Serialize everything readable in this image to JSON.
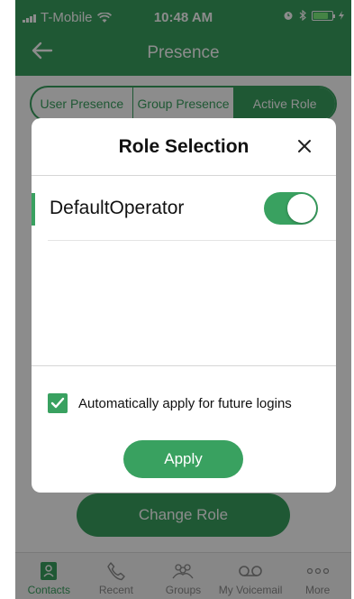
{
  "status_bar": {
    "carrier": "T-Mobile",
    "time": "10:48 AM"
  },
  "header": {
    "title": "Presence",
    "back_icon": "back-arrow-icon"
  },
  "segments": [
    {
      "label": "User Presence",
      "active": false
    },
    {
      "label": "Group Presence",
      "active": false
    },
    {
      "label": "Active Role",
      "active": true
    }
  ],
  "change_role_label": "Change Role",
  "tabs": [
    {
      "label": "Contacts",
      "icon": "contacts-icon",
      "active": true
    },
    {
      "label": "Recent",
      "icon": "phone-icon",
      "active": false
    },
    {
      "label": "Groups",
      "icon": "groups-icon",
      "active": false
    },
    {
      "label": "My Voicemail",
      "icon": "voicemail-icon",
      "active": false
    },
    {
      "label": "More",
      "icon": "more-icon",
      "active": false
    }
  ],
  "modal": {
    "title": "Role Selection",
    "roles": [
      {
        "name": "DefaultOperator",
        "enabled": true
      }
    ],
    "auto_apply_label": "Automatically apply for future logins",
    "auto_apply_checked": true,
    "apply_label": "Apply"
  },
  "colors": {
    "accent": "#39a160",
    "overlay": "rgba(0,0,0,0.45)"
  }
}
